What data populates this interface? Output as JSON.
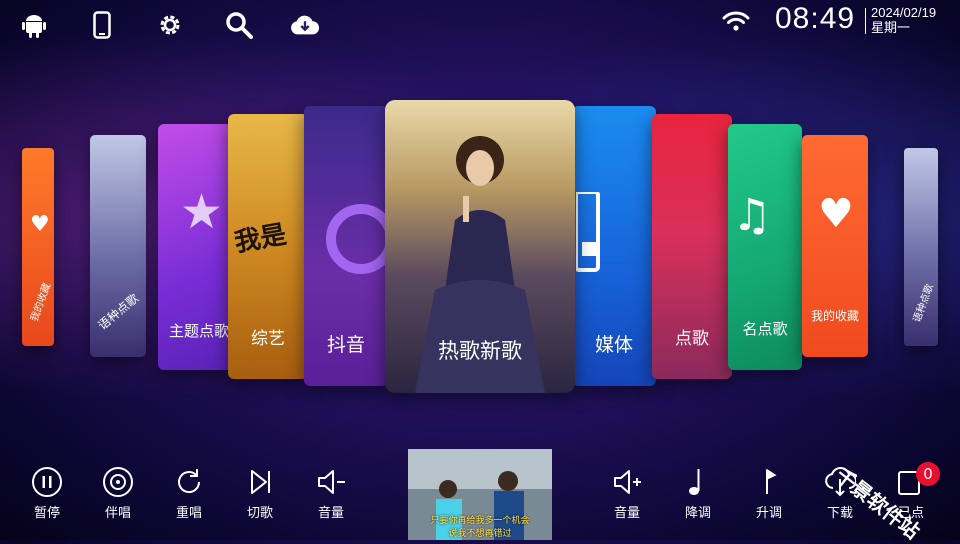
{
  "status": {
    "time": "08:49",
    "date": "2024/02/19",
    "weekday": "星期一"
  },
  "top_icons": [
    "android-icon",
    "phone-icon",
    "settings-icon",
    "search-icon",
    "cloud-download-icon"
  ],
  "cards": {
    "c1": "我的收藏",
    "c2": "语种点歌",
    "c3": "主题点歌",
    "c4": "综艺",
    "c5": "抖音",
    "center": "热歌新歌",
    "c7": "媒体",
    "c8": "点歌",
    "c9": "名点歌",
    "c10": "我的收藏",
    "c11": "语种点歌"
  },
  "controls_left": [
    {
      "label": "暂停",
      "icon": "pause-icon"
    },
    {
      "label": "伴唱",
      "icon": "disc-icon"
    },
    {
      "label": "重唱",
      "icon": "replay-icon"
    },
    {
      "label": "切歌",
      "icon": "skip-icon"
    },
    {
      "label": "音量",
      "icon": "volume-down-icon"
    }
  ],
  "controls_right": [
    {
      "label": "音量",
      "icon": "volume-up-icon"
    },
    {
      "label": "降调",
      "icon": "note-down-icon"
    },
    {
      "label": "升调",
      "icon": "note-up-icon"
    },
    {
      "label": "下载",
      "icon": "download-icon"
    },
    {
      "label": "已点",
      "icon": "queue-icon"
    }
  ],
  "queue_count": "0",
  "video": {
    "lyric1": "只要你再给我多一个机会",
    "lyric2": "说我不想再错过"
  },
  "watermark": "千景软件站",
  "colors": {
    "accent": "#e8102e"
  }
}
